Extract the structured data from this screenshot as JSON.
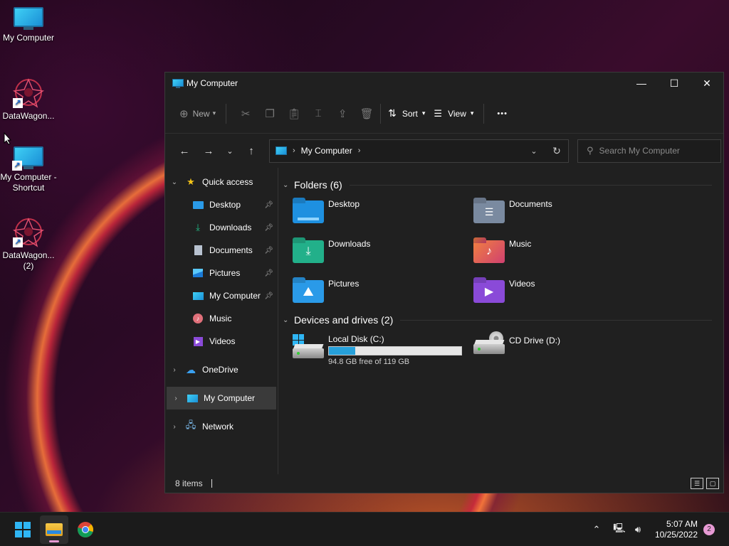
{
  "desktop": {
    "icons": [
      {
        "label": "My Computer"
      },
      {
        "label": "DataWagon..."
      },
      {
        "label": "My Computer - Shortcut"
      },
      {
        "label": "DataWagon... (2)"
      }
    ]
  },
  "window": {
    "title": "My Computer",
    "minimize_glyph": "—",
    "maximize_glyph": "☐",
    "close_glyph": "✕"
  },
  "cmdbar": {
    "new_label": "New",
    "sort_label": "Sort",
    "view_label": "View",
    "more_label": "•••"
  },
  "address": {
    "crumb": "My Computer",
    "search_placeholder": "Search My Computer"
  },
  "navpane": {
    "quick_access": "Quick access",
    "items": [
      {
        "label": "Desktop",
        "icon": "desktop-icon"
      },
      {
        "label": "Downloads",
        "icon": "downloads-icon"
      },
      {
        "label": "Documents",
        "icon": "documents-icon"
      },
      {
        "label": "Pictures",
        "icon": "pictures-icon"
      },
      {
        "label": "My Computer",
        "icon": "computer-icon"
      },
      {
        "label": "Music",
        "icon": "music-icon"
      },
      {
        "label": "Videos",
        "icon": "videos-icon"
      }
    ],
    "onedrive": "OneDrive",
    "my_computer": "My Computer",
    "network": "Network"
  },
  "content": {
    "folders_header": "Folders (6)",
    "folders": [
      {
        "name": "Desktop",
        "color": "#1e90e0"
      },
      {
        "name": "Documents",
        "color": "#7a8aa0"
      },
      {
        "name": "Downloads",
        "color": "#22b08a"
      },
      {
        "name": "Music",
        "color": "#e0604a"
      },
      {
        "name": "Pictures",
        "color": "#2a9ae8"
      },
      {
        "name": "Videos",
        "color": "#8a4ad8"
      }
    ],
    "drives_header": "Devices and drives (2)",
    "drives": [
      {
        "name": "Local Disk (C:)",
        "free": "94.8 GB free of 119 GB",
        "used_fraction": 0.2
      },
      {
        "name": "CD Drive (D:)"
      }
    ]
  },
  "status": {
    "items": "8 items"
  },
  "taskbar": {
    "time": "5:07 AM",
    "date": "10/25/2022",
    "notifications": "2"
  }
}
